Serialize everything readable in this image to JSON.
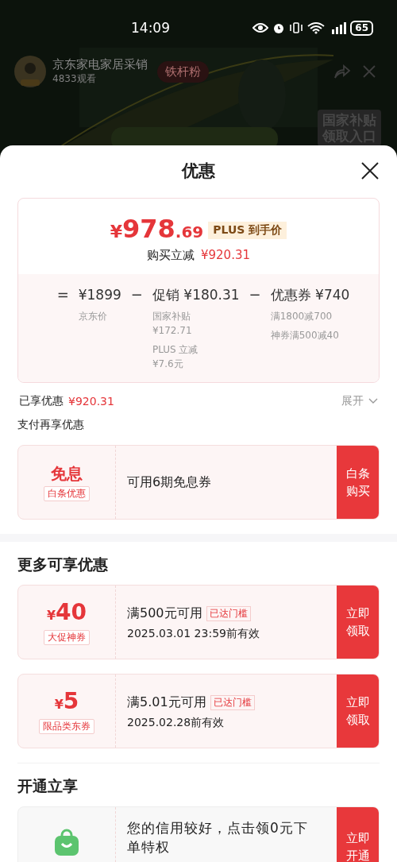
{
  "status_bar": {
    "time": "14:09",
    "battery": "65"
  },
  "live": {
    "host_name": "京东家电家居采销",
    "viewers": "4833观看",
    "fan_badge": "铁杆粉",
    "entry_lines": [
      "国家补贴",
      "领取入口"
    ]
  },
  "sheet": {
    "title": "优惠"
  },
  "price_card": {
    "currency": "¥",
    "price_int": "978",
    "price_dec": ".69",
    "price_tag": "PLUS 到手价",
    "reduction_label": "购买立减",
    "reduction_value": "¥920.31",
    "breakdown": [
      {
        "operator": "=",
        "heading": "¥1899",
        "groups": [
          [
            "京东价"
          ]
        ]
      },
      {
        "operator": "−",
        "heading": "促销 ¥180.31",
        "groups": [
          [
            "国家补贴",
            "¥172.71"
          ],
          [
            "PLUS 立减",
            "¥7.6元"
          ]
        ]
      },
      {
        "operator": "−",
        "heading": "优惠券 ¥740",
        "groups": [
          [
            "满1800减700"
          ],
          [
            "神券满500减40"
          ]
        ]
      }
    ]
  },
  "enjoyed": {
    "label": "已享优惠",
    "value": "¥920.31",
    "expand": "展开"
  },
  "pay_section": {
    "title": "支付再享优惠",
    "offers": [
      {
        "kind": "text",
        "main": "免息",
        "tag": "白条优惠",
        "text": "可用6期免息券",
        "action": "白条购买"
      }
    ]
  },
  "more_section": {
    "title": "更多可享优惠",
    "offers": [
      {
        "kind": "amount",
        "currency": "¥",
        "amount": "40",
        "tag": "大促神券",
        "condition": "满500元可用",
        "badge": "已达门槛",
        "validity": "2025.03.01 23:59前有效",
        "action": "立即领取"
      },
      {
        "kind": "amount",
        "currency": "¥",
        "amount": "5",
        "tag": "限品类东券",
        "condition": "满5.01元可用",
        "badge": "已达门槛",
        "validity": "2025.02.28前有效",
        "action": "立即领取"
      }
    ]
  },
  "open_section": {
    "title": "开通立享",
    "offers": [
      {
        "kind": "icon",
        "text": "您的信用较好，点击领0元下单特权",
        "action": "立即开通"
      }
    ]
  }
}
